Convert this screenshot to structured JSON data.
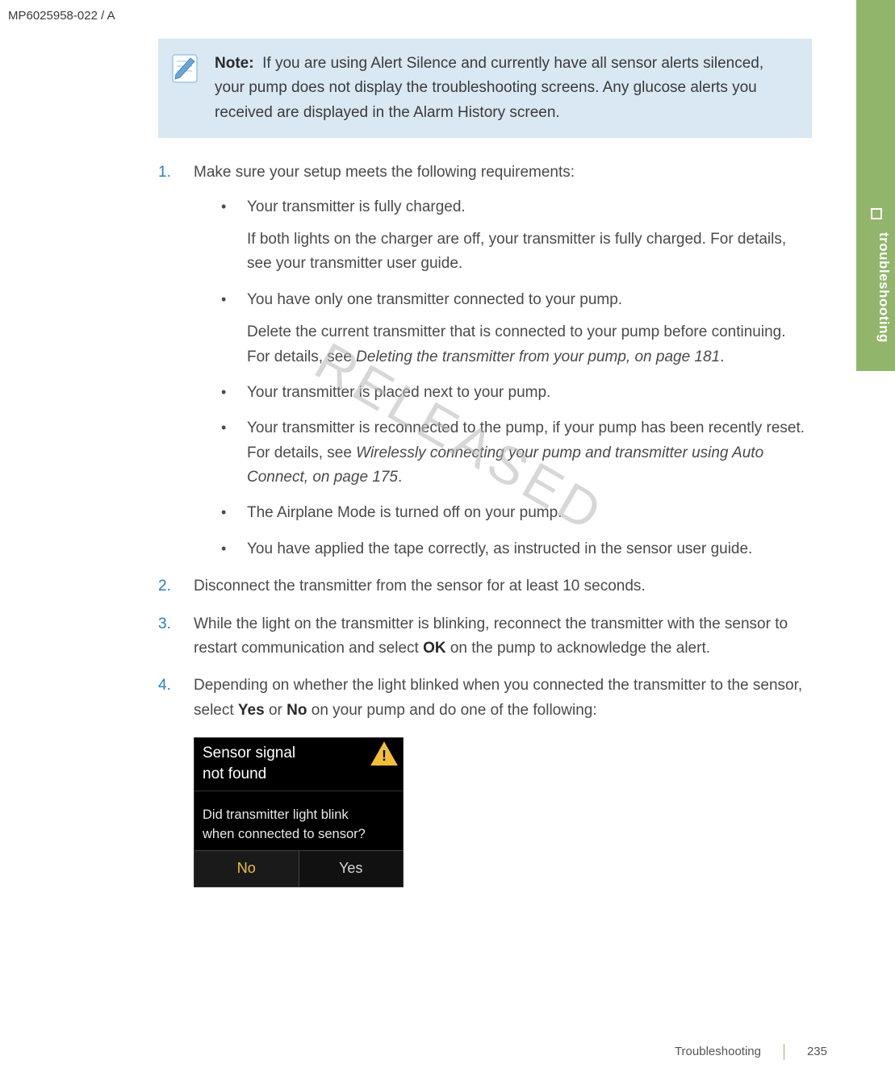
{
  "doc_id": "MP6025958-022 / A",
  "side_tab": {
    "label": "troubleshooting"
  },
  "note": {
    "label": "Note:",
    "text": "If you are using Alert Silence and currently have all sensor alerts silenced, your pump does not display the troubleshooting screens. Any glucose alerts you received are displayed in the Alarm History screen."
  },
  "steps": {
    "s1_intro": "Make sure your setup meets the following requirements:",
    "s1_b1a": "Your transmitter is fully charged.",
    "s1_b1b": "If both lights on the charger are off, your transmitter is fully charged. For details, see your transmitter user guide.",
    "s1_b2a": "You have only one transmitter connected to your pump.",
    "s1_b2b_pre": "Delete the current transmitter that is connected to your pump before continuing. For details, see ",
    "s1_b2b_ital": "Deleting the transmitter from your pump, on page 181",
    "s1_b2b_post": ".",
    "s1_b3": "Your transmitter is placed next to your pump.",
    "s1_b4_pre": "Your transmitter is reconnected to the pump, if your pump has been recently reset. For details, see ",
    "s1_b4_ital": "Wirelessly connecting your pump and transmitter using Auto Connect, on page 175",
    "s1_b4_post": ".",
    "s1_b5": "The Airplane Mode is turned off on your pump.",
    "s1_b6": "You have applied the tape correctly, as instructed in the sensor user guide.",
    "s2": "Disconnect the transmitter from the sensor for at least 10 seconds.",
    "s3_pre": "While the light on the transmitter is blinking, reconnect the transmitter with the sensor to restart communication and select ",
    "s3_bold": "OK",
    "s3_post": " on the pump to acknowledge the alert.",
    "s4_pre": "Depending on whether the light blinked when you connected the transmitter to the sensor, select ",
    "s4_b1": "Yes",
    "s4_mid": " or ",
    "s4_b2": "No",
    "s4_post": " on your pump and do one of the following:"
  },
  "pump": {
    "title_l1": "Sensor signal",
    "title_l2": "not found",
    "body_l1": "Did transmitter light blink",
    "body_l2": "when connected to sensor?",
    "btn_no": "No",
    "btn_yes": "Yes"
  },
  "watermark": "RELEASED",
  "footer": {
    "section": "Troubleshooting",
    "page": "235"
  }
}
